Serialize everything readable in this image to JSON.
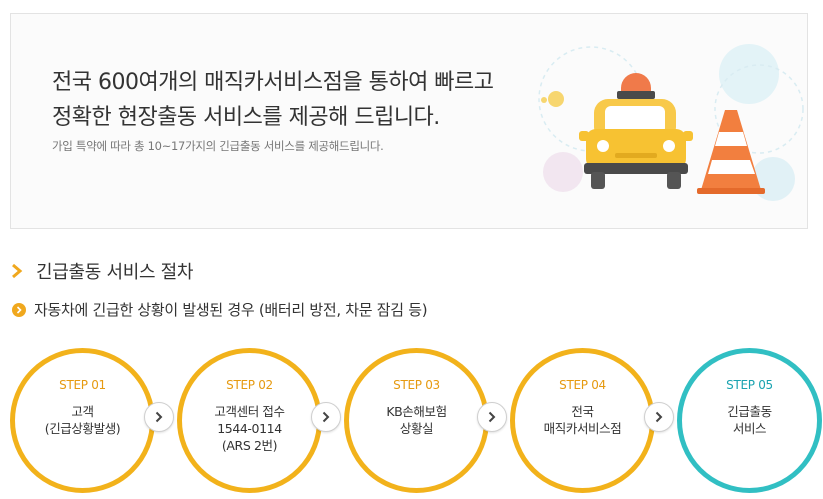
{
  "banner": {
    "headline_line1": "전국 600여개의 매직카서비스점을 통하여 빠르고",
    "headline_line2": "정확한 현장출동 서비스를 제공해 드립니다.",
    "subline": "가입 특약에 따라 총 10~17가지의 긴급출동 서비스를 제공해드립니다."
  },
  "section": {
    "title": "긴급출동 서비스 절차",
    "subtitle": "자동차에 긴급한 상황이 발생된 경우 (배터리 방전, 차문 잠김 등)"
  },
  "steps": [
    {
      "label": "STEP 01",
      "text": [
        "고객",
        "(긴급상황발생)"
      ]
    },
    {
      "label": "STEP 02",
      "text": [
        "고객센터 접수",
        "1544-0114",
        "(ARS 2번)"
      ]
    },
    {
      "label": "STEP 03",
      "text": [
        "KB손해보험",
        "상황실"
      ]
    },
    {
      "label": "STEP 04",
      "text": [
        "전국",
        "매직카서비스점"
      ]
    },
    {
      "label": "STEP 05",
      "text": [
        "긴급출동",
        "서비스"
      ]
    }
  ],
  "colors": {
    "step_border": "#f2b21b",
    "step_border_final": "#31bfc3",
    "accent": "#f0a81e"
  },
  "icons": {
    "section_bullet": "double-chevron-right-icon",
    "sub_bullet": "circle-chevron-icon",
    "step_arrow": "chevron-right-icon",
    "illustration": "tow-truck-with-traffic-cone"
  }
}
